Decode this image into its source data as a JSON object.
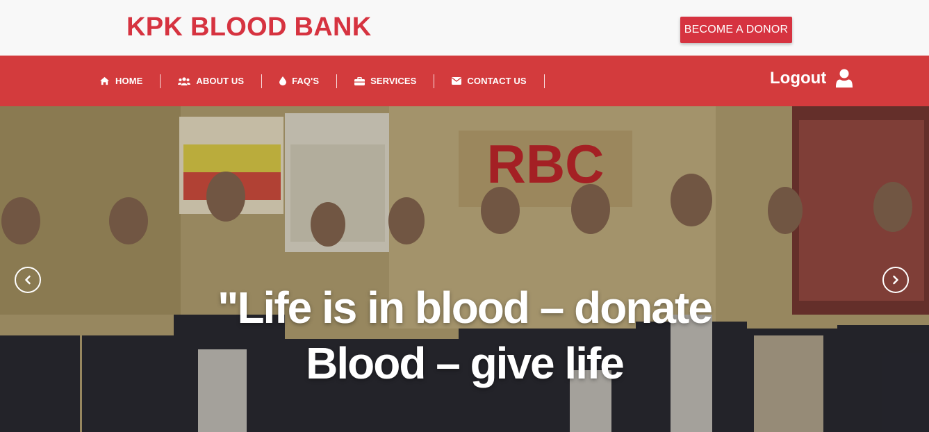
{
  "header": {
    "brand": "KPK BLOOD BANK",
    "donor_button": "BECOME A DONOR"
  },
  "nav": {
    "items": [
      {
        "label": "HOME",
        "icon": "home-icon"
      },
      {
        "label": "ABOUT US",
        "icon": "users-icon"
      },
      {
        "label": "FAQ'S",
        "icon": "droplet-icon"
      },
      {
        "label": "SERVICES",
        "icon": "briefcase-icon"
      },
      {
        "label": "CONTACT US",
        "icon": "envelope-icon"
      }
    ],
    "logout": "Logout",
    "logout_icon": "user-icon"
  },
  "hero": {
    "caption_line1": "\"Life is in blood – donate",
    "caption_line2": "Blood – give life",
    "sign_text": "RBC",
    "prev_icon": "chevron-left-icon",
    "next_icon": "chevron-right-icon"
  },
  "colors": {
    "brand_red": "#d63340",
    "nav_red": "#d33b3d"
  }
}
